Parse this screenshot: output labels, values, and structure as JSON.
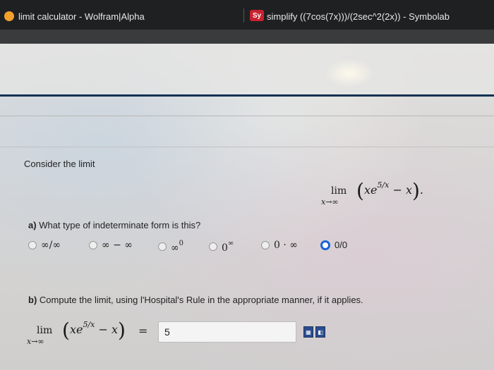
{
  "tabs": [
    {
      "icon": "wolfram-icon",
      "title": "limit calculator - Wolfram|Alpha"
    },
    {
      "icon": "symbolab-icon",
      "badge": "Sy",
      "title": "simplify ((7cos(7x)))/(2sec^2(2x)) - Symbolab"
    }
  ],
  "problem": {
    "intro": "Consider the limit",
    "limit": {
      "lim": "lim",
      "sub": "x→∞",
      "base": "xe",
      "exp": "5/x",
      "tail": "− x",
      "end": "."
    }
  },
  "part_a": {
    "label": "a)",
    "question": "What type of indeterminate form is this?",
    "options": [
      {
        "label": "∞/∞",
        "selected": false
      },
      {
        "label": "∞ − ∞",
        "selected": false
      },
      {
        "label": "∞",
        "sup": "0",
        "selected": false
      },
      {
        "label": "0",
        "sup": "∞",
        "selected": false
      },
      {
        "label": "0 · ∞",
        "selected": false
      },
      {
        "label": "0/0",
        "selected": true
      }
    ]
  },
  "part_b": {
    "label": "b)",
    "question": "Compute the limit, using l'Hospital's Rule in the appropriate manner, if it applies.",
    "equals": "=",
    "answer": "5"
  },
  "colors": {
    "accent": "#1a64d6",
    "rule": "#123052"
  }
}
